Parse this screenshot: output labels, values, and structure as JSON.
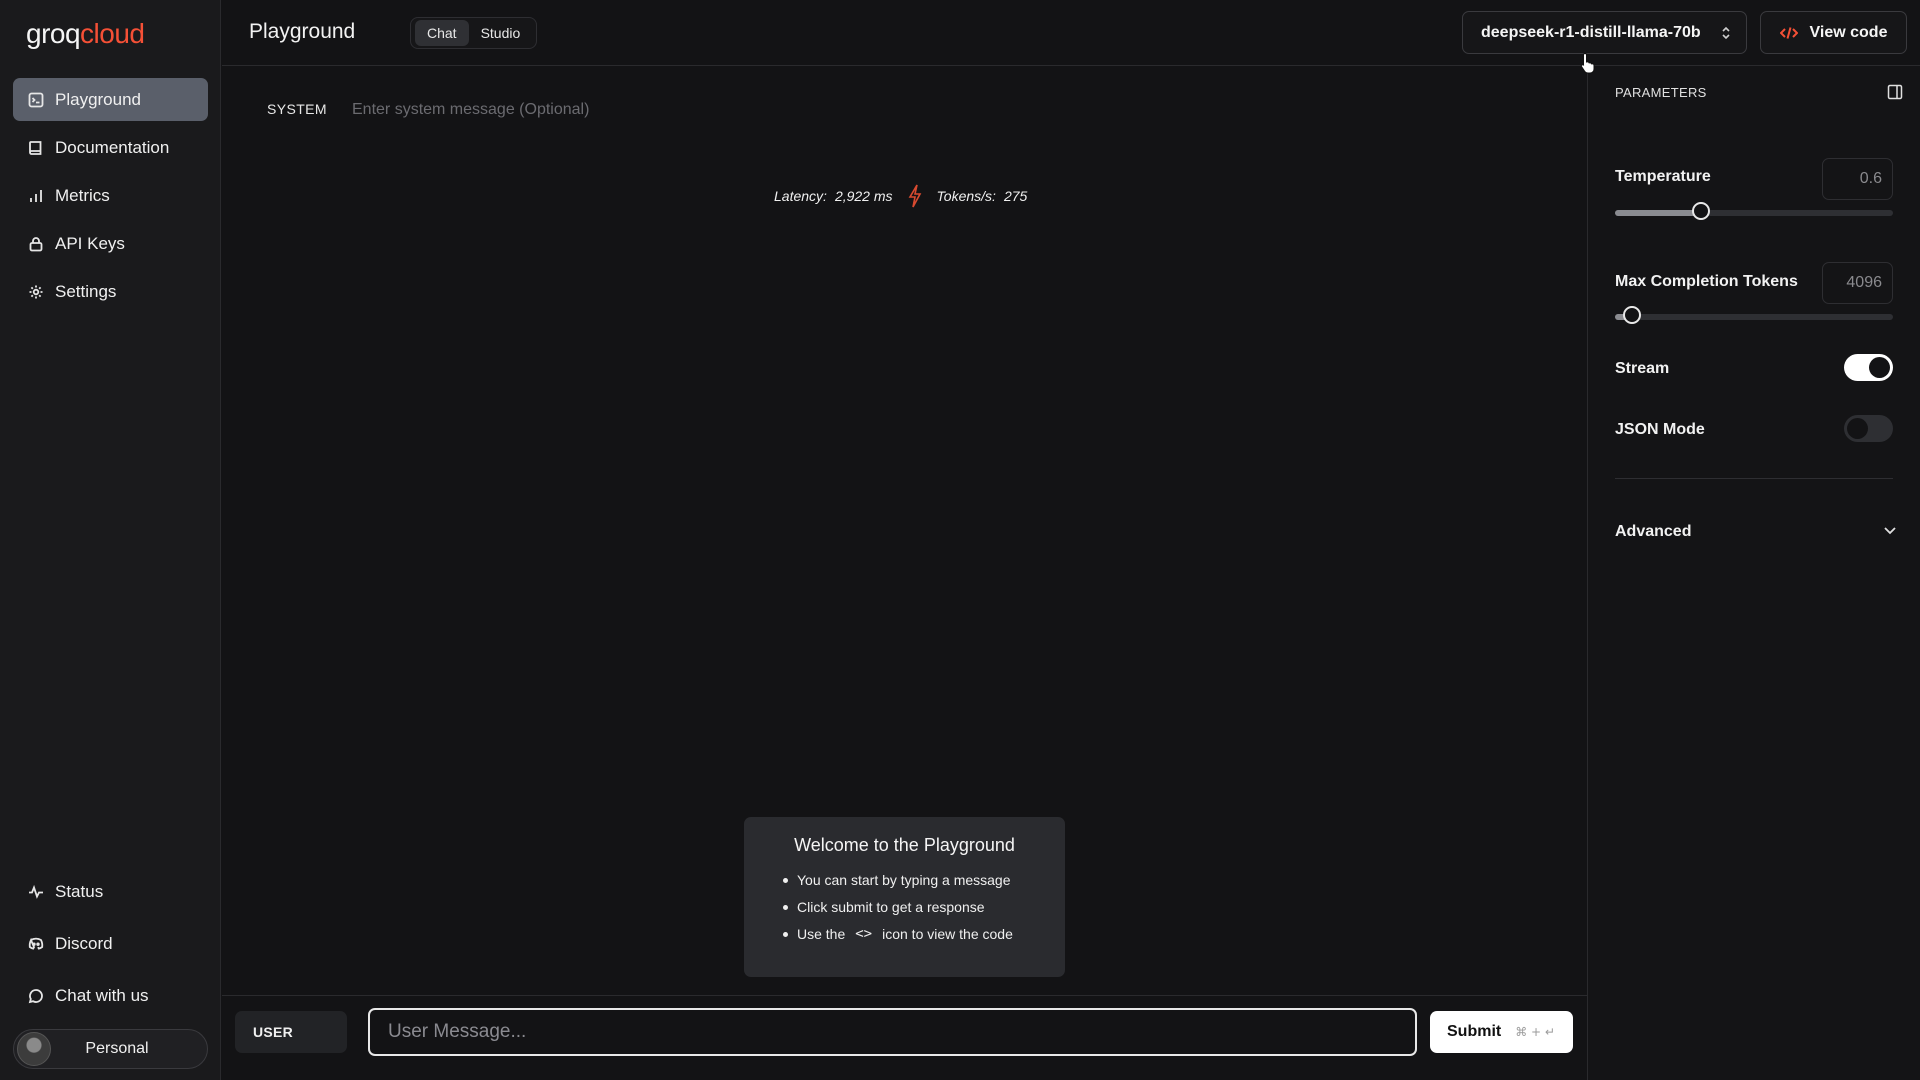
{
  "brand": {
    "logo_groq": "groq",
    "logo_cloud": "cloud"
  },
  "sidebar": {
    "items": [
      {
        "label": "Playground",
        "icon": "playground-icon",
        "active": true
      },
      {
        "label": "Documentation",
        "icon": "book-icon"
      },
      {
        "label": "Metrics",
        "icon": "bar-chart-icon"
      },
      {
        "label": "API Keys",
        "icon": "lock-icon"
      },
      {
        "label": "Settings",
        "icon": "gear-icon"
      }
    ],
    "bottom_items": [
      {
        "label": "Status",
        "icon": "activity-icon"
      },
      {
        "label": "Discord",
        "icon": "discord-icon"
      },
      {
        "label": "Chat with us",
        "icon": "chat-bubble-icon"
      }
    ],
    "account_label": "Personal"
  },
  "header": {
    "title": "Playground",
    "tabs": [
      {
        "label": "Chat",
        "active": true
      },
      {
        "label": "Studio"
      }
    ],
    "model": "deepseek-r1-distill-llama-70b",
    "view_code_label": "View code"
  },
  "system": {
    "label": "SYSTEM",
    "placeholder": "Enter system message (Optional)"
  },
  "stats": {
    "latency_label": "Latency:",
    "latency_value": "2,922 ms",
    "tokens_label": "Tokens/s:",
    "tokens_value": "275"
  },
  "welcome": {
    "title": "Welcome to the Playground",
    "item1": "You can start by typing a message",
    "item2": "Click submit to get a response",
    "item3_before": "Use the",
    "item3_glyph": "<>",
    "item3_after": "icon to view the code"
  },
  "composer": {
    "role_label": "USER",
    "placeholder": "User Message...",
    "submit_label": "Submit",
    "submit_hint": "⌘ + ↵"
  },
  "parameters": {
    "title": "PARAMETERS",
    "temperature": {
      "label": "Temperature",
      "value": "0.6",
      "fraction": 0.31
    },
    "max_tokens": {
      "label": "Max Completion Tokens",
      "value": "4096",
      "fraction": 0.06
    },
    "stream": {
      "label": "Stream",
      "enabled": true
    },
    "json_mode": {
      "label": "JSON Mode",
      "enabled": false
    },
    "advanced_label": "Advanced"
  },
  "colors": {
    "accent": "#f55036",
    "background": "#131315",
    "sidebar": "#1a1a1c",
    "active_nav": "#5a5f6a"
  }
}
